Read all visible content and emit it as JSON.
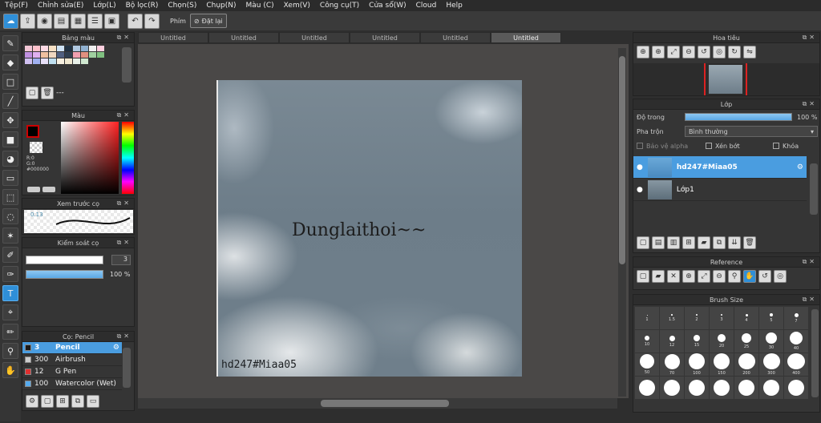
{
  "menu": [
    "Tệp(F)",
    "Chỉnh sửa(E)",
    "Lớp(L)",
    "Bộ lọc(R)",
    "Chọn(S)",
    "Chụp(N)",
    "Màu (C)",
    "Xem(V)",
    "Công cụ(T)",
    "Cửa sổ(W)",
    "Cloud",
    "Help"
  ],
  "toolbar": {
    "key_label": "Phím",
    "reset_label": "Đặt lại"
  },
  "palette_panel": {
    "title": "Bảng màu",
    "label": "---",
    "colors": [
      "#f3c7d6",
      "#ffc2cc",
      "#ffdbe5",
      "#f7e1c4",
      "#cfe3f5",
      "#203040",
      "#b0c8e0",
      "#90b0d0",
      "#f0f0f0",
      "#ffd0e0",
      "#c090e0",
      "#e0b0f0",
      "#f0c0a0",
      "#f0d8c0",
      "#506080",
      "#304050",
      "#f0a0b0",
      "#e09080",
      "#a0d0a0",
      "#80c080",
      "#d0c0f0",
      "#a0b0f0",
      "#e8e0f8",
      "#c0e0f0",
      "#f8f0e0",
      "#f0e8d0",
      "#e8f0e8",
      "#d0e8d0"
    ]
  },
  "color_panel": {
    "title": "Màu",
    "rgb": [
      "R:0",
      "G:0",
      "#000000"
    ]
  },
  "preview_panel": {
    "title": "Xem trước cọ",
    "size": "0.13"
  },
  "control_panel": {
    "title": "Kiểm soát cọ",
    "size_value": "3",
    "opacity_value": "100 %"
  },
  "brush_panel": {
    "title": "Cọ: Pencil",
    "brushes": [
      {
        "size": "3",
        "name": "Pencil",
        "color": "#1a1a1a",
        "sel": true
      },
      {
        "size": "300",
        "name": "Airbrush",
        "color": "#ccc"
      },
      {
        "size": "12",
        "name": "G Pen",
        "color": "#e03030"
      },
      {
        "size": "100",
        "name": "Watercolor (Wet)",
        "color": "#55aaee"
      }
    ]
  },
  "tabs": [
    "Untitled",
    "Untitled",
    "Untitled",
    "Untitled",
    "Untitled",
    "Untitled"
  ],
  "canvas": {
    "caption": "Dunglaithoi~~",
    "watermark": "hd247#Miaa05"
  },
  "navigator": {
    "title": "Hoa tiêu"
  },
  "layer_panel": {
    "title": "Lớp",
    "opacity_label": "Độ trong",
    "opacity_value": "100 %",
    "blend_label": "Pha trộn",
    "blend_value": "Bình thường",
    "protect_alpha": "Bảo vệ alpha",
    "clipping": "Xén bớt",
    "lock": "Khóa",
    "layers": [
      {
        "name": "hd247#Miaa05",
        "sel": true
      },
      {
        "name": "Lớp1",
        "sel": false
      }
    ]
  },
  "reference_panel": {
    "title": "Reference"
  },
  "brushsize_panel": {
    "title": "Brush Size",
    "sizes": [
      "1",
      "1.5",
      "2",
      "3",
      "4",
      "5",
      "7",
      "10",
      "12",
      "15",
      "20",
      "25",
      "30",
      "40",
      "50",
      "70",
      "100",
      "150",
      "200",
      "300",
      "400",
      "",
      "",
      "",
      "",
      "",
      "",
      ""
    ]
  }
}
